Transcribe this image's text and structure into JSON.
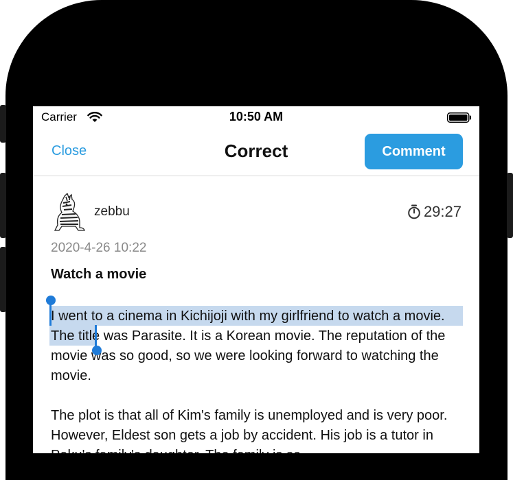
{
  "status_bar": {
    "carrier": "Carrier",
    "time": "10:50 AM",
    "wifi_icon": "wifi-icon",
    "battery_icon": "battery-full-icon"
  },
  "nav": {
    "close_label": "Close",
    "title": "Correct",
    "comment_label": "Comment",
    "accent_color": "#2b9ce0"
  },
  "post": {
    "avatar_icon": "zebra-avatar",
    "username": "zebbu",
    "timer": "29:27",
    "timer_icon": "stopwatch-icon",
    "date": "2020-4-26 10:22",
    "title": "Watch a movie",
    "paragraphs": [
      "I went to a cinema in Kichijoji with my girlfriend to watch a movie. The title was Parasite. It is a Korean movie. The reputation of the movie was so good, so we were looking forward to watching the movie.",
      "The plot is that all of Kim's family is unemployed and is very poor. However, Eldest son gets a job by accident. His job is a tutor in Paku's family's daughter. The family is so"
    ],
    "selected_text": "I went to a cinema in Kichijoji with my girlfriend to watch a movie."
  }
}
